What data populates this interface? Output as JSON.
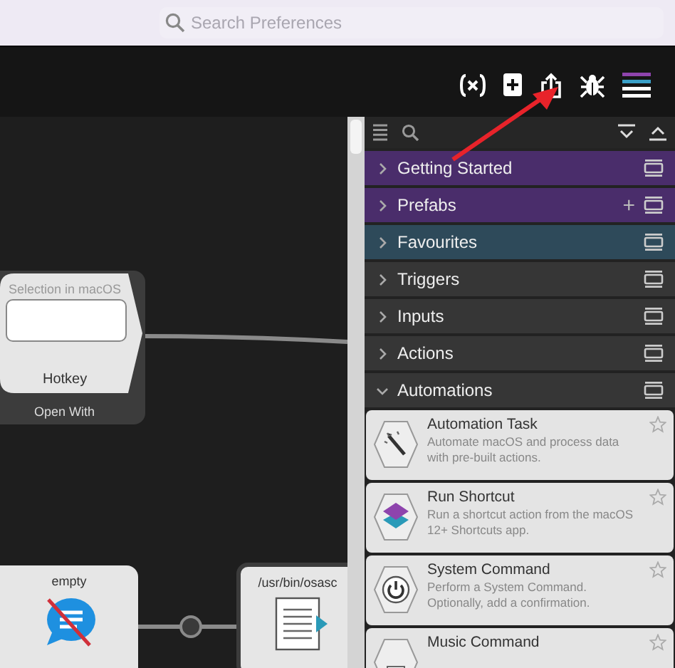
{
  "search": {
    "placeholder": "Search Preferences"
  },
  "canvas": {
    "hotkey_node": {
      "field_label": "Selection in macOS",
      "title": "Hotkey",
      "footer": "Open With"
    },
    "message_node": {
      "title": "empty"
    },
    "script_node": {
      "title": "/usr/bin/osasc"
    }
  },
  "sidebar": {
    "categories": [
      {
        "label": "Getting Started",
        "expanded": false,
        "color": "#4a2d6b"
      },
      {
        "label": "Prefabs",
        "expanded": false,
        "color": "#4a2d6b",
        "action": "+"
      },
      {
        "label": "Favourites",
        "expanded": false,
        "color": "#2e4a5a"
      },
      {
        "label": "Triggers",
        "expanded": false,
        "color": "#363636"
      },
      {
        "label": "Inputs",
        "expanded": false,
        "color": "#363636"
      },
      {
        "label": "Actions",
        "expanded": false,
        "color": "#363636"
      },
      {
        "label": "Automations",
        "expanded": true,
        "color": "#363636"
      }
    ],
    "items": [
      {
        "kind": "wand",
        "title": "Automation Task",
        "description": "Automate macOS and process data with pre-built actions."
      },
      {
        "kind": "layers",
        "title": "Run Shortcut",
        "description": "Run a shortcut action from the macOS 12+ Shortcuts app."
      },
      {
        "kind": "power",
        "title": "System Command",
        "description": "Perform a System Command. Optionally, add a confirmation."
      },
      {
        "kind": "music",
        "title": "Music Command"
      }
    ]
  }
}
